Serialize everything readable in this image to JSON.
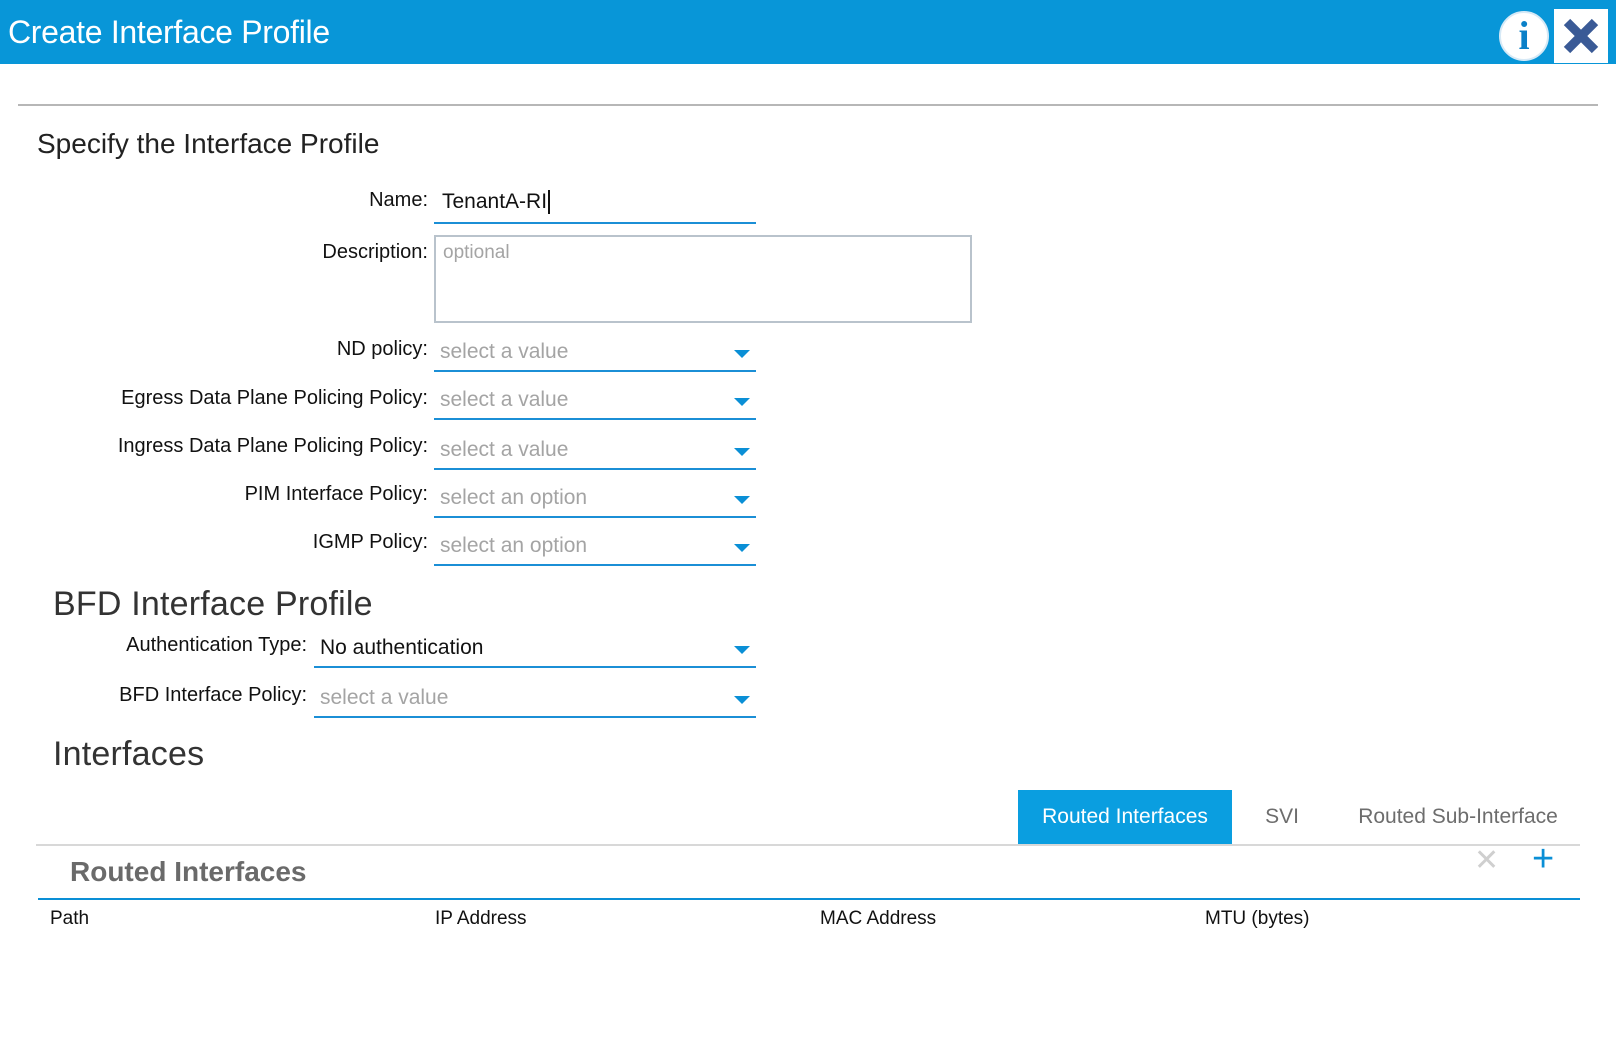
{
  "dialog": {
    "title": "Create Interface Profile",
    "info_icon": "info-icon",
    "close_icon": "close-icon"
  },
  "profile": {
    "section_title": "Specify the Interface Profile",
    "name_label": "Name:",
    "name_value": "TenantA-RI",
    "description_label": "Description:",
    "description_placeholder": "optional",
    "nd_policy_label": "ND policy:",
    "nd_policy_value": "select a value",
    "egress_label": "Egress Data Plane Policing Policy:",
    "egress_value": "select a value",
    "ingress_label": "Ingress Data Plane Policing Policy:",
    "ingress_value": "select a value",
    "pim_label": "PIM Interface Policy:",
    "pim_value": "select an option",
    "igmp_label": "IGMP Policy:",
    "igmp_value": "select an option"
  },
  "bfd": {
    "section_title": "BFD Interface Profile",
    "auth_label": "Authentication Type:",
    "auth_value": "No authentication",
    "policy_label": "BFD Interface Policy:",
    "policy_value": "select a value"
  },
  "interfaces": {
    "section_title": "Interfaces",
    "tabs": [
      {
        "label": "Routed Interfaces",
        "active": true
      },
      {
        "label": "SVI",
        "active": false
      },
      {
        "label": "Routed Sub-Interface",
        "active": false
      }
    ],
    "grid_title": "Routed Interfaces",
    "delete_glyph": "✕",
    "add_glyph": "+",
    "columns": [
      "Path",
      "IP Address",
      "MAC Address",
      "MTU (bytes)"
    ]
  },
  "colors": {
    "accent": "#0896d8",
    "tab_active": "#0a9ee0",
    "close_icon": "#3a5a96"
  }
}
